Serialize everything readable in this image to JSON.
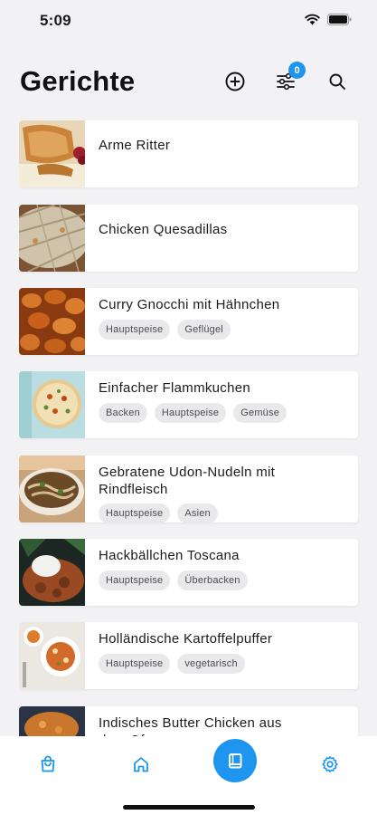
{
  "status_bar": {
    "time": "5:09"
  },
  "header": {
    "title": "Gerichte",
    "filter_count": "0"
  },
  "recipes": [
    {
      "title": "Arme Ritter",
      "tags": []
    },
    {
      "title": "Chicken Quesadillas",
      "tags": []
    },
    {
      "title": "Curry Gnocchi mit Hähnchen",
      "tags": [
        "Hauptspeise",
        "Geflügel"
      ]
    },
    {
      "title": "Einfacher Flammkuchen",
      "tags": [
        "Backen",
        "Hauptspeise",
        "Gemüse"
      ]
    },
    {
      "title": "Gebratene Udon-Nudeln mit Rindfleisch",
      "tags": [
        "Hauptspeise",
        "Asien"
      ]
    },
    {
      "title": "Hackbällchen Toscana",
      "tags": [
        "Hauptspeise",
        "Überbacken"
      ]
    },
    {
      "title": "Holländische Kartoffelpuffer",
      "tags": [
        "Hauptspeise",
        "vegetarisch"
      ]
    },
    {
      "title": "Indisches Butter Chicken aus dem Ofen",
      "tags": []
    }
  ],
  "tabs": [
    {
      "name": "cart-icon"
    },
    {
      "name": "home-icon"
    },
    {
      "name": "recipe-book-icon",
      "active": true
    },
    {
      "name": "gear-icon"
    }
  ],
  "colors": {
    "accent": "#1e95ee",
    "background": "#f2f2f4",
    "tag_bg": "#e9e9ec"
  }
}
